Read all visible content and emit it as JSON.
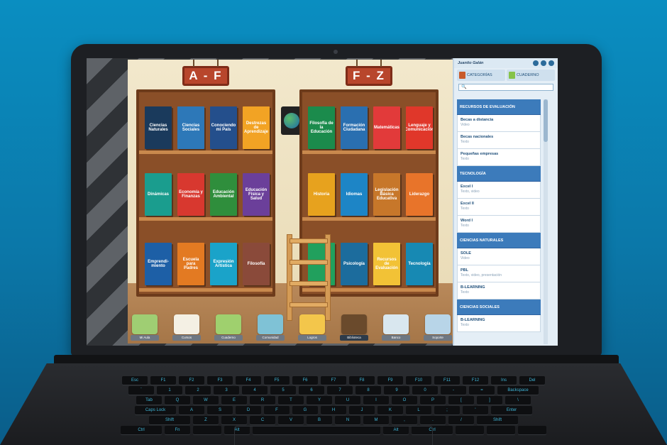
{
  "app": {
    "signs": [
      "A - F",
      "F - Z"
    ],
    "left_shelf": {
      "row1": [
        {
          "title": "Ciencias Naturales",
          "color": "#1a3a5c"
        },
        {
          "title": "Ciencias Sociales",
          "color": "#2d78b8"
        },
        {
          "title": "Conociendo mi País",
          "color": "#244f8c"
        },
        {
          "title": "Destrezas de Aprendizaje",
          "color": "#f2a324"
        }
      ],
      "row2": [
        {
          "title": "Dinámicas",
          "color": "#1a9d8e"
        },
        {
          "title": "Economía y Finanzas",
          "color": "#d8382f"
        },
        {
          "title": "Educación Ambiental",
          "color": "#2f8e3c"
        },
        {
          "title": "Educación Física y Salud",
          "color": "#6b3f9a"
        }
      ],
      "row3": [
        {
          "title": "Emprendi- miento",
          "color": "#1d5fa6"
        },
        {
          "title": "Escuela para Padres",
          "color": "#e37a22"
        },
        {
          "title": "Expresión Artística",
          "color": "#1aa3c9"
        },
        {
          "title": "Filosofía",
          "color": "#8a4a3a"
        }
      ]
    },
    "right_shelf": {
      "row1": [
        {
          "title": "Filosofía de la Educación",
          "color": "#1b8b4c"
        },
        {
          "title": "Formación Ciudadana",
          "color": "#2a6fb0"
        },
        {
          "title": "Matemáticas",
          "color": "#e23a3a"
        },
        {
          "title": "Lenguaje y Comunicación",
          "color": "#e0372a"
        }
      ],
      "row2": [
        {
          "title": "Historia",
          "color": "#e7a21e"
        },
        {
          "title": "Idiomas",
          "color": "#1d85c6"
        },
        {
          "title": "Legislación Básica Educativa",
          "color": "#c7772a"
        },
        {
          "title": "Liderazgo",
          "color": "#e8742a"
        }
      ],
      "row3": [
        {
          "title": "",
          "color": "#21a05d"
        },
        {
          "title": "Psicología",
          "color": "#1c6c9d"
        },
        {
          "title": "Recursos de Evaluación",
          "color": "#f2c236"
        },
        {
          "title": "Tecnología",
          "color": "#1789b3"
        }
      ]
    },
    "dock": [
      {
        "label": "Mi Aula",
        "icon": "classroom-icon",
        "color": "#9fce73"
      },
      {
        "label": "Cursos",
        "icon": "courses-icon",
        "color": "#f4f0e4"
      },
      {
        "label": "Cuaderno",
        "icon": "notebook-icon",
        "color": "#9fd06e"
      },
      {
        "label": "Comunidad",
        "icon": "community-icon",
        "color": "#7fc2d6"
      },
      {
        "label": "Logros",
        "icon": "trophy-icon",
        "color": "#f3c64b"
      },
      {
        "label": "Biblioteca",
        "icon": "library-icon",
        "color": "#6a4a2c"
      },
      {
        "label": "Banco",
        "icon": "bank-icon",
        "color": "#d9e7ef"
      },
      {
        "label": "Soporte",
        "icon": "support-icon",
        "color": "#b8d5e8"
      }
    ]
  },
  "sidebar": {
    "user": "Juanito Galán",
    "tabs": [
      {
        "label": "CATEGORÍAS",
        "color": "#c85a2a"
      },
      {
        "label": "CUADERNO",
        "color": "#86c34a"
      }
    ],
    "search_placeholder": "🔍",
    "sections": [
      {
        "title": "RECURSOS DE EVALUACIÓN",
        "items": [
          {
            "name": "Becas a distancia",
            "type": "Video"
          },
          {
            "name": "Becas nacionales",
            "type": "Texto"
          },
          {
            "name": "Pequeñas empresas",
            "type": "Texto"
          }
        ]
      },
      {
        "title": "TECNOLOGÍA",
        "items": [
          {
            "name": "Excel I",
            "type": "Texto, video"
          },
          {
            "name": "Excel II",
            "type": "Texto"
          },
          {
            "name": "Word I",
            "type": "Texto"
          }
        ]
      },
      {
        "title": "CIENCIAS NATURALES",
        "items": [
          {
            "name": "SOLE",
            "type": "Video"
          },
          {
            "name": "PBL",
            "type": "Texto, video, presentación"
          },
          {
            "name": "B-LEARNING",
            "type": "Texto"
          }
        ]
      },
      {
        "title": "CIENCIAS SOCIALES",
        "items": [
          {
            "name": "B-LEARNING",
            "type": "Texto"
          }
        ]
      }
    ]
  },
  "keyboard": {
    "rows": [
      [
        "Esc",
        "F1",
        "F2",
        "F3",
        "F4",
        "F5",
        "F6",
        "F7",
        "F8",
        "F9",
        "F10",
        "F11",
        "F12",
        "Ins",
        "Del"
      ],
      [
        "`",
        "1",
        "2",
        "3",
        "4",
        "5",
        "6",
        "7",
        "8",
        "9",
        "0",
        "-",
        "=",
        "Backspace"
      ],
      [
        "Tab",
        "Q",
        "W",
        "E",
        "R",
        "T",
        "Y",
        "U",
        "I",
        "O",
        "P",
        "[",
        "]",
        "\\"
      ],
      [
        "Caps Lock",
        "A",
        "S",
        "D",
        "F",
        "G",
        "H",
        "J",
        "K",
        "L",
        ";",
        "'",
        "Enter"
      ],
      [
        "Shift",
        "Z",
        "X",
        "C",
        "V",
        "B",
        "N",
        "M",
        ",",
        ".",
        "/",
        "Shift"
      ],
      [
        "Ctrl",
        "Fn",
        "",
        "Alt",
        "",
        "Alt",
        "Ctrl",
        "",
        "",
        ""
      ]
    ]
  }
}
